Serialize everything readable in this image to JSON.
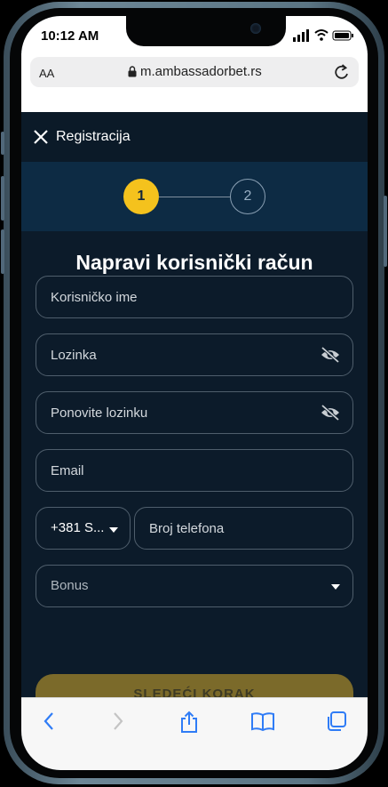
{
  "status": {
    "time": "10:12 AM"
  },
  "browser": {
    "aa_label": "AA",
    "url": "m.ambassadorbet.rs"
  },
  "header": {
    "title": "Registracija"
  },
  "stepper": {
    "step1": "1",
    "step2": "2"
  },
  "form": {
    "title": "Napravi korisnički račun",
    "username_placeholder": "Korisničko ime",
    "password_placeholder": "Lozinka",
    "repeat_password_placeholder": "Ponovite lozinku",
    "email_placeholder": "Email",
    "country_code": "+381 S...",
    "phone_placeholder": "Broj telefona",
    "bonus_placeholder": "Bonus",
    "next_button": "SLEDEĆI KORAK"
  },
  "colors": {
    "accent": "#f4c21d",
    "background": "#0c1b2a",
    "stepper_bg": "#0d2b44"
  },
  "icons": [
    "close-icon",
    "eye-off-icon",
    "lock-icon",
    "reload-icon",
    "back-icon",
    "forward-icon",
    "share-icon",
    "bookmarks-icon",
    "tabs-icon"
  ]
}
